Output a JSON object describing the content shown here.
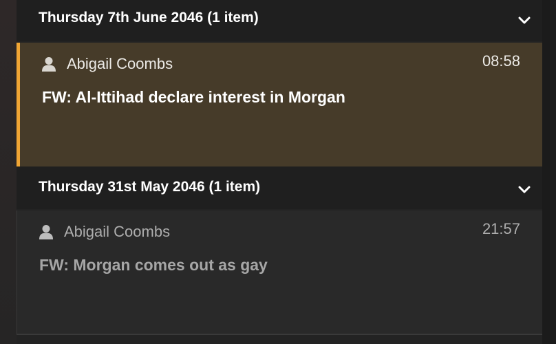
{
  "groups": [
    {
      "title": "Thursday 7th June 2046 (1 item)",
      "messages": [
        {
          "sender": "Abigail Coombs",
          "time": "08:58",
          "subject": "FW: Al-Ittihad declare interest in Morgan",
          "unread": true
        }
      ]
    },
    {
      "title": "Thursday 31st May 2046 (1 item)",
      "messages": [
        {
          "sender": "Abigail Coombs",
          "time": "21:57",
          "subject": "FW: Morgan comes out as gay",
          "unread": false
        }
      ]
    }
  ],
  "colors": {
    "unread_accent": "#f0a534",
    "unread_background": "#463b29",
    "header_background": "#1f1f1f",
    "read_background": "#292929"
  },
  "icons": {
    "sender": "user-icon",
    "collapse": "chevron-down-icon"
  }
}
